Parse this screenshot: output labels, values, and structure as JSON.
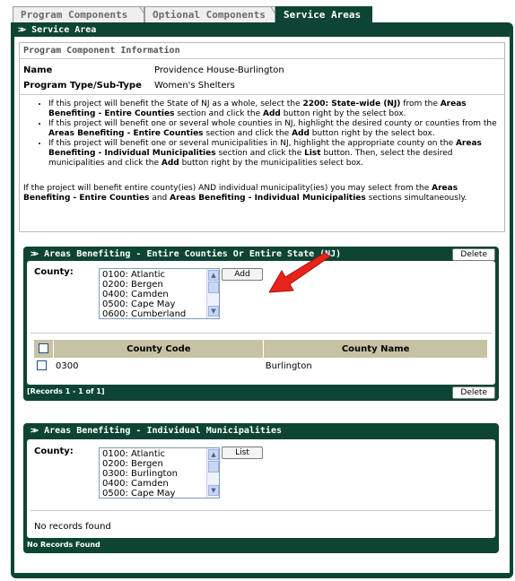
{
  "tabs": [
    {
      "label": "Program Components"
    },
    {
      "label": "Optional Components"
    },
    {
      "label": "Service Areas"
    }
  ],
  "service_area": {
    "title": "Service Area",
    "info": {
      "heading": "Program Component Information",
      "name_label": "Name",
      "name_value": "Providence House-Burlington",
      "type_label": "Program Type/Sub-Type",
      "type_value": "Women's Shelters",
      "bullet1_a": "If this project will benefit the State of NJ as a whole, select the ",
      "bullet1_b": "2200: State-wide (NJ)",
      "bullet1_c": " from the ",
      "bullet1_d": "Areas Benefiting - Entire Counties",
      "bullet1_e": " section and click the ",
      "bullet1_f": "Add",
      "bullet1_g": " button right by the select box.",
      "bullet2_a": "If this project will benefit one or several whole counties in NJ, highlight the desired county or counties from the ",
      "bullet2_b": "Areas Benefiting - Entire Counties",
      "bullet2_c": " section and click the ",
      "bullet2_d": "Add",
      "bullet2_e": " button right by the select box.",
      "bullet3_a": "If this project will benefit one or several municipalities in NJ, highlight the appropriate county on the ",
      "bullet3_b": "Areas Benefiting - Individual Municipalities",
      "bullet3_c": " section and click the ",
      "bullet3_d": "List",
      "bullet3_e": " button. Then, select the desired municipalities and click the ",
      "bullet3_f": "Add",
      "bullet3_g": " button right by the municipalities select box.",
      "summary_a": "If the project will benefit entire county(ies) AND individual municipality(ies) you may select from the ",
      "summary_b": "Areas Benefiting - Entire Counties",
      "summary_c": " and ",
      "summary_d": "Areas Benefiting - Individual Municipalities",
      "summary_e": " sections simultaneously."
    },
    "counties_panel": {
      "title": "Areas Benefiting - Entire Counties Or Entire State (NJ)",
      "delete_label": "Delete",
      "county_label": "County:",
      "options": [
        "0100: Atlantic",
        "0200: Bergen",
        "0400: Camden",
        "0500: Cape May",
        "0600: Cumberland"
      ],
      "add_label": "Add",
      "columns": [
        "County Code",
        "County Name"
      ],
      "rows": [
        {
          "code": "0300",
          "name": "Burlington"
        }
      ],
      "records": "[Records 1 - 1 of 1]",
      "delete_bottom_label": "Delete"
    },
    "muni_panel": {
      "title": "Areas Benefiting - Individual Municipalities",
      "county_label": "County:",
      "options": [
        "0100: Atlantic",
        "0200: Bergen",
        "0300: Burlington",
        "0400: Camden",
        "0500: Cape May"
      ],
      "list_label": "List",
      "empty_text": "No records found",
      "footer": "No Records Found"
    }
  },
  "colors": {
    "frame": "#0e4434",
    "header_bar": "#c8c2a4",
    "arrow": "#e8231c"
  }
}
